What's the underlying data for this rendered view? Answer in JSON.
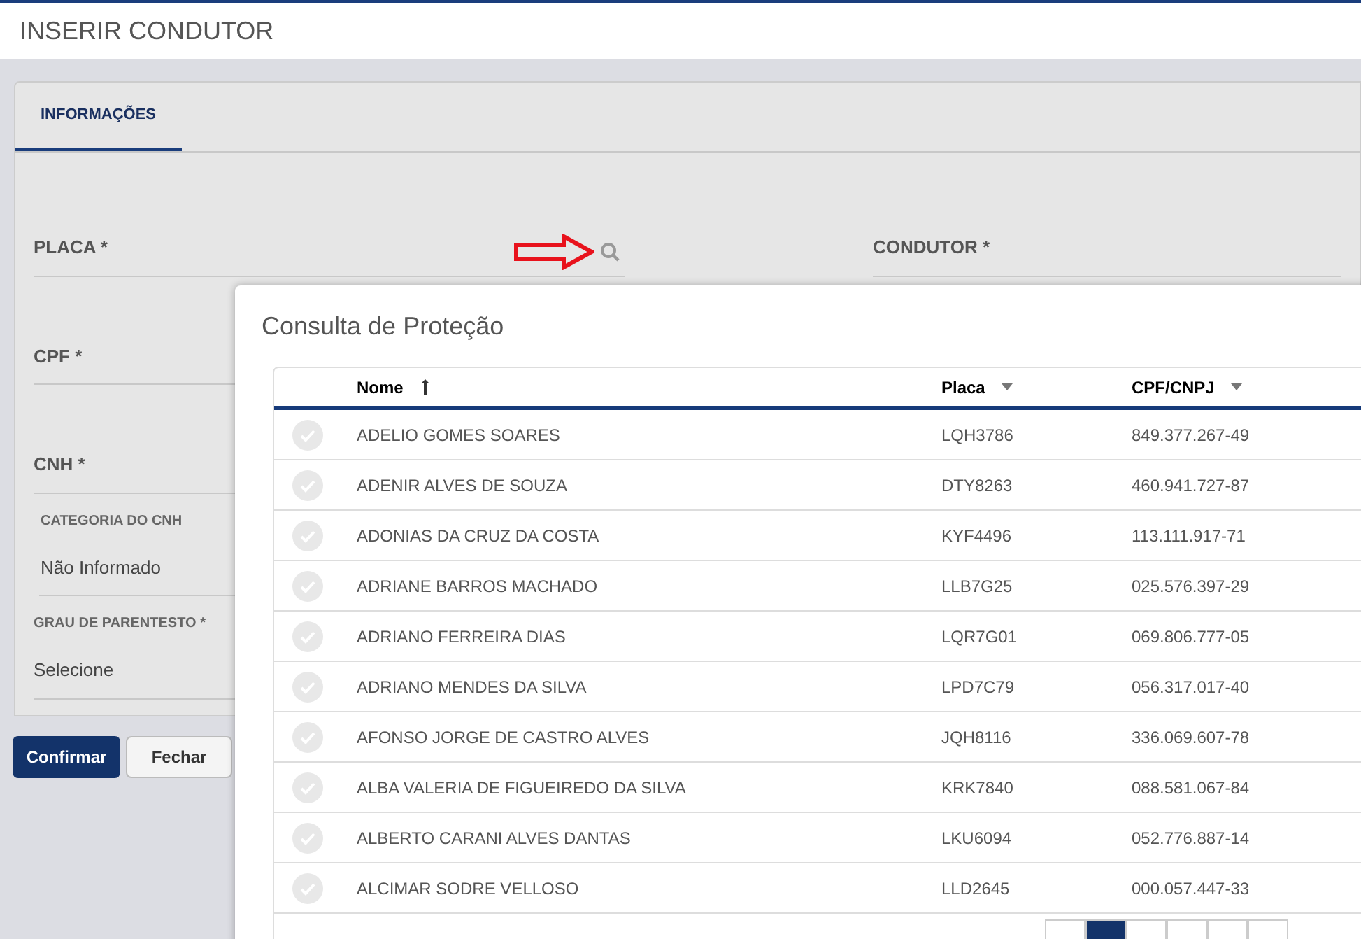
{
  "page_title": "INSERIR CONDUTOR",
  "tabs": [
    {
      "label": "INFORMAÇÕES",
      "selected": true
    }
  ],
  "fields": {
    "placa": {
      "label": "PLACA *"
    },
    "condutor": {
      "label": "CONDUTOR *"
    },
    "cpf": {
      "label": "CPF *"
    },
    "cnh": {
      "label": "CNH *"
    },
    "categoria": {
      "label": "CATEGORIA DO CNH",
      "value": "Não Informado"
    },
    "grau": {
      "label": "GRAU DE PARENTESTO *",
      "value": "Selecione"
    }
  },
  "buttons": [
    {
      "label": "Confirmar",
      "kind": "primary"
    },
    {
      "label": "Fechar",
      "kind": "secondary"
    }
  ],
  "modal": {
    "title": "Consulta de Proteção",
    "columns": [
      {
        "label": "Nome",
        "sorted": true
      },
      {
        "label": "Placa",
        "sorted": false
      },
      {
        "label": "CPF/CNPJ",
        "sorted": false
      }
    ],
    "rows": [
      {
        "nome": "ADELIO GOMES SOARES",
        "placa": "LQH3786",
        "cpf": "849.377.267-49"
      },
      {
        "nome": "ADENIR ALVES DE SOUZA",
        "placa": "DTY8263",
        "cpf": "460.941.727-87"
      },
      {
        "nome": "ADONIAS DA CRUZ DA COSTA",
        "placa": "KYF4496",
        "cpf": "113.111.917-71"
      },
      {
        "nome": "ADRIANE BARROS MACHADO",
        "placa": "LLB7G25",
        "cpf": "025.576.397-29"
      },
      {
        "nome": "ADRIANO FERREIRA DIAS",
        "placa": "LQR7G01",
        "cpf": "069.806.777-05"
      },
      {
        "nome": "ADRIANO MENDES DA SILVA",
        "placa": "LPD7C79",
        "cpf": "056.317.017-40"
      },
      {
        "nome": "AFONSO JORGE DE CASTRO ALVES",
        "placa": "JQH8116",
        "cpf": "336.069.607-78"
      },
      {
        "nome": "ALBA VALERIA DE FIGUEIREDO DA SILVA",
        "placa": "KRK7840",
        "cpf": "088.581.067-84"
      },
      {
        "nome": "ALBERTO CARANI ALVES DANTAS",
        "placa": "LKU6094",
        "cpf": "052.776.887-14"
      },
      {
        "nome": "ALCIMAR SODRE VELLOSO",
        "placa": "LLD2645",
        "cpf": "000.057.447-33"
      }
    ],
    "pagination": [
      {
        "selected": false
      },
      {
        "selected": true
      },
      {
        "selected": false
      },
      {
        "selected": false
      },
      {
        "selected": false
      },
      {
        "selected": false
      }
    ]
  }
}
